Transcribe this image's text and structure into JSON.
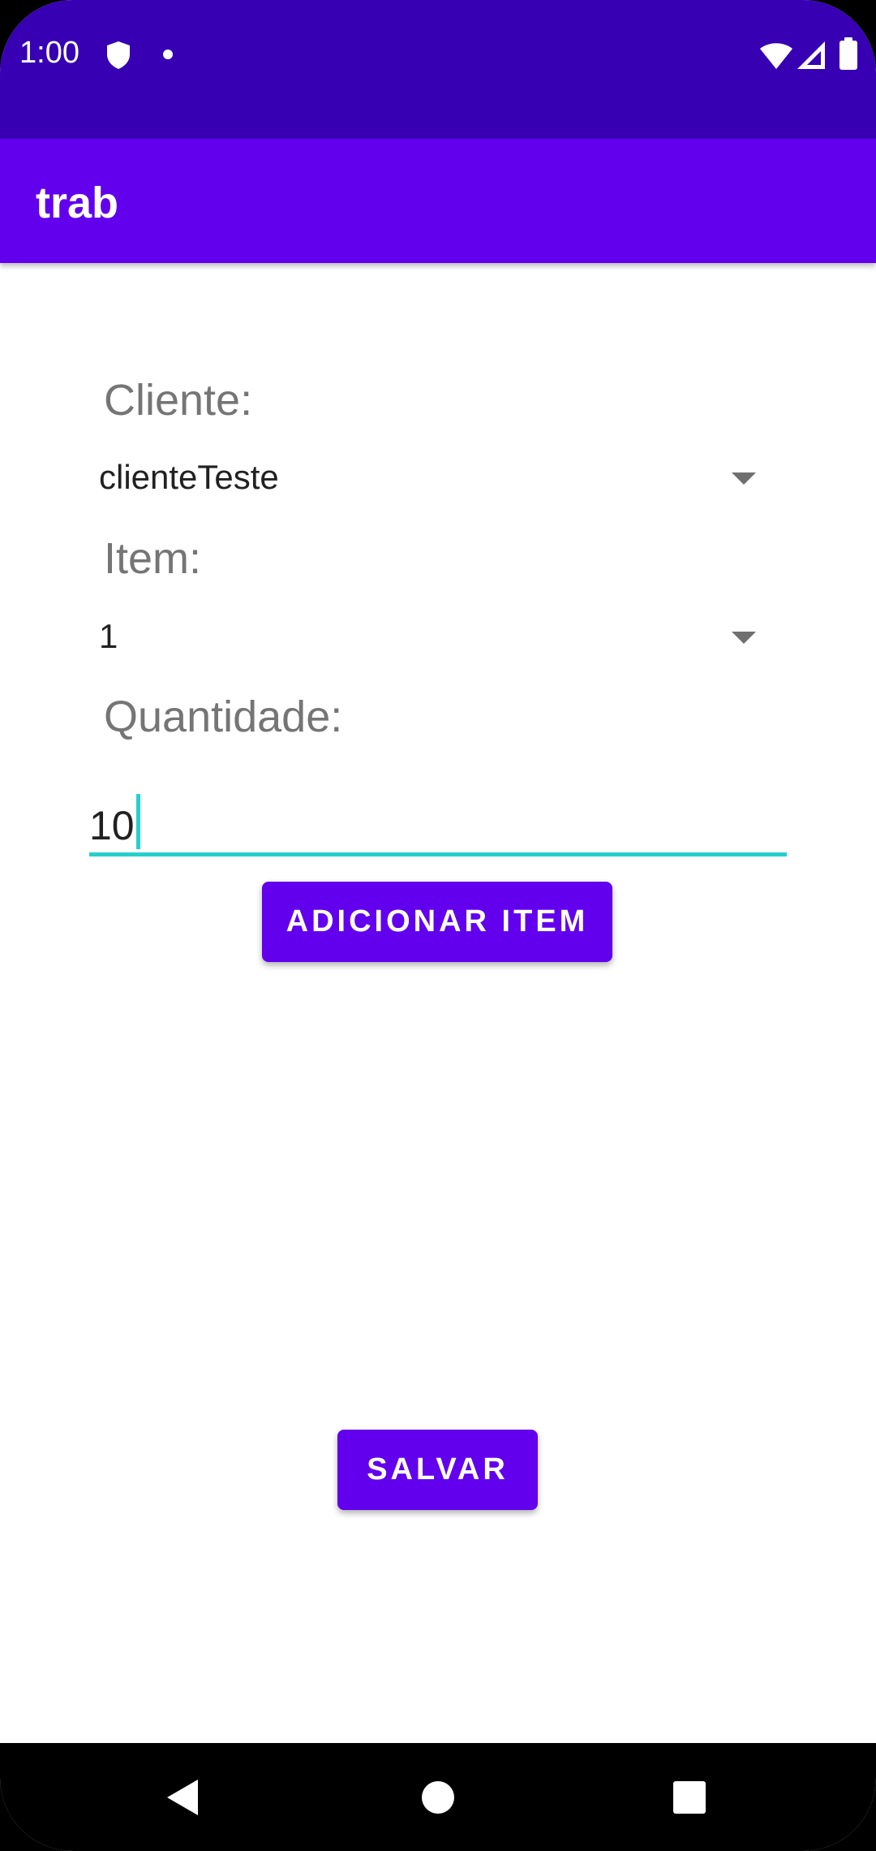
{
  "status_bar": {
    "time": "1:00"
  },
  "app_bar": {
    "title": "trab"
  },
  "form": {
    "cliente_label": "Cliente:",
    "cliente_value": "clienteTeste",
    "item_label": "Item:",
    "item_value": "1",
    "quantidade_label": "Quantidade:",
    "quantidade_value": "10",
    "add_button_label": "ADICIONAR ITEM",
    "save_button_label": "SALVAR"
  },
  "colors": {
    "status_bar": "#3700b3",
    "primary": "#6200ee",
    "accent": "#26d0ce"
  },
  "icons": {
    "status": [
      "shield-icon",
      "notification-dot-icon",
      "wifi-icon",
      "signal-icon",
      "battery-icon"
    ],
    "nav": [
      "back-icon",
      "home-icon",
      "recents-icon"
    ]
  }
}
